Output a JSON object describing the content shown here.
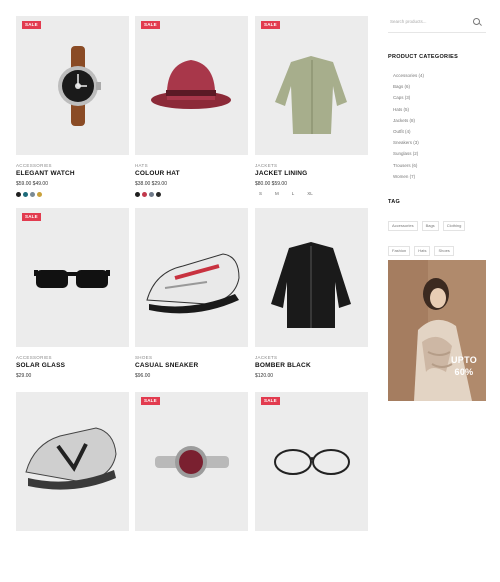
{
  "products": [
    {
      "id": "p1",
      "badge": "SALE",
      "category": "ACCESSORIES",
      "name": "ELEGANT WATCH",
      "price": "$59.00 $49.00",
      "colors": [
        "#1f1f1f",
        "#1e6b7a",
        "#7a8a95",
        "#c9a13b"
      ],
      "image": "watch-icon"
    },
    {
      "id": "p2",
      "badge": "SALE",
      "category": "HATS",
      "name": "COLOUR HAT",
      "price": "$38.00 $29.00",
      "colors": [
        "#1f1f1f",
        "#c1394c",
        "#6f7a8a",
        "#2b2b2b"
      ],
      "image": "hat-icon"
    },
    {
      "id": "p3",
      "badge": "SALE",
      "category": "JACKETS",
      "name": "JACKET LINING",
      "price": "$80.00 $59.00",
      "sizes": [
        "S",
        "M",
        "L",
        "XL"
      ],
      "image": "jacket-icon"
    },
    {
      "id": "p4",
      "badge": "SALE",
      "category": "ACCESSORIES",
      "name": "SOLAR GLASS",
      "price": "$29.00",
      "image": "sunglasses-icon"
    },
    {
      "id": "p5",
      "badge": "",
      "category": "SHOES",
      "name": "CASUAL SNEAKER",
      "price": "$96.00",
      "image": "sneaker-icon"
    },
    {
      "id": "p6",
      "badge": "",
      "category": "JACKETS",
      "name": "BOMBER BLACK",
      "price": "$120.00",
      "image": "bomber-jacket-icon"
    },
    {
      "id": "p7",
      "badge": "",
      "category": "",
      "name": "",
      "price": "",
      "image": "running-shoe-icon"
    },
    {
      "id": "p8",
      "badge": "SALE",
      "category": "",
      "name": "",
      "price": "",
      "image": "wristwatch-icon"
    },
    {
      "id": "p9",
      "badge": "SALE",
      "category": "",
      "name": "",
      "price": "",
      "image": "eyeglasses-icon"
    }
  ],
  "sidebar": {
    "search_placeholder": "Search products...",
    "categories_title": "PRODUCT CATEGORIES",
    "categories": [
      "Accessories (4)",
      "Bags (6)",
      "Caps (3)",
      "Hats (5)",
      "Jackets (8)",
      "Outfit (4)",
      "Sneakers (3)",
      "Sunglass (2)",
      "Trousers (6)",
      "Women (7)"
    ],
    "tags_title": "TAG",
    "tags": [
      "Accessories",
      "Bags",
      "Clothing",
      "Fashion",
      "Hats",
      "Shoes"
    ],
    "promo": {
      "line1": "UPTO",
      "line2": "60%"
    }
  }
}
